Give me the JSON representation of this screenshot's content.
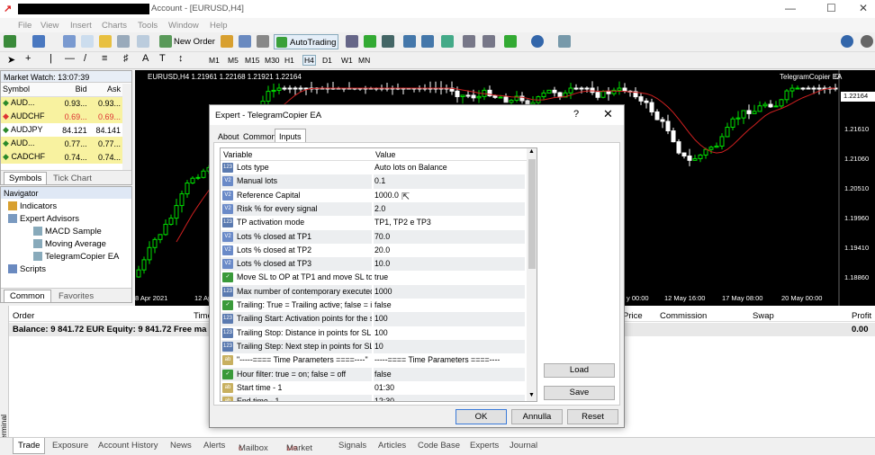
{
  "window": {
    "title": "Account - [EURUSD,H4]"
  },
  "menu": [
    "File",
    "View",
    "Insert",
    "Charts",
    "Tools",
    "Window",
    "Help"
  ],
  "toolbar": {
    "new_order": "New Order",
    "autotrading": "AutoTrading"
  },
  "timeframes": [
    "M1",
    "M5",
    "M15",
    "M30",
    "H1",
    "H4",
    "D1",
    "W1",
    "MN"
  ],
  "market_watch": {
    "title": "Market Watch: 13:07:39",
    "columns": [
      "Symbol",
      "Bid",
      "Ask"
    ],
    "rows": [
      [
        "AUD...",
        "0.93...",
        "0.93..."
      ],
      [
        "AUDCHF",
        "0.69...",
        "0.69..."
      ],
      [
        "AUDJPY",
        "84.121",
        "84.141"
      ],
      [
        "AUD...",
        "0.77...",
        "0.77..."
      ],
      [
        "CADCHF",
        "0.74...",
        "0.74..."
      ]
    ],
    "tabs": [
      "Symbols",
      "Tick Chart"
    ]
  },
  "navigator": {
    "title": "Navigator",
    "items": [
      "Indicators",
      "Expert Advisors",
      "MACD Sample",
      "Moving Average",
      "TelegramCopier EA",
      "Scripts"
    ],
    "tabs": [
      "Common",
      "Favorites"
    ]
  },
  "chart": {
    "symbol_info": "EURUSD,H4 1.21961 1.22168 1.21921 1.22164",
    "ea_label": "TelegramCopier EA",
    "price_labels": [
      "1.22164",
      "1.21610",
      "1.21060",
      "1.20510",
      "1.19960",
      "1.19410",
      "1.18860"
    ],
    "time_labels": [
      "8 Apr 2021",
      "12 Ap",
      "y 00:00",
      "12 May 16:00",
      "17 May 08:00",
      "20 May 00:00"
    ]
  },
  "terminal": {
    "columns": [
      "Order",
      "Time",
      "Price",
      "Commission",
      "Swap",
      "Profit"
    ],
    "balance": "Balance: 9 841.72 EUR  Equity: 9 841.72  Free ma",
    "profit": "0.00"
  },
  "bottom_tabs": [
    {
      "label": "Trade"
    },
    {
      "label": "Exposure"
    },
    {
      "label": "Account History"
    },
    {
      "label": "News"
    },
    {
      "label": "Alerts"
    },
    {
      "label": "Mailbox",
      "badge": "6"
    },
    {
      "label": "Market",
      "badge": "140"
    },
    {
      "label": "Signals"
    },
    {
      "label": "Articles"
    },
    {
      "label": "Code Base"
    },
    {
      "label": "Experts"
    },
    {
      "label": "Journal"
    }
  ],
  "terminal_side_label": "Terminal",
  "dialog": {
    "title": "Expert - TelegramCopier EA",
    "help": "?",
    "tabs": [
      "About",
      "Common",
      "Inputs"
    ],
    "active_tab": "Inputs",
    "columns": [
      "Variable",
      "Value"
    ],
    "rows": [
      {
        "icon": "123",
        "var": "Lots type",
        "val": "Auto lots on Balance"
      },
      {
        "icon": "V2",
        "var": "Manual lots",
        "val": "0.1"
      },
      {
        "icon": "V2",
        "var": "Reference Capital",
        "val": "1000.0"
      },
      {
        "icon": "V2",
        "var": "Risk % for every signal",
        "val": "2.0"
      },
      {
        "icon": "123",
        "var": "TP activation mode",
        "val": "TP1, TP2 e TP3"
      },
      {
        "icon": "V2",
        "var": "Lots % closed at TP1",
        "val": "70.0"
      },
      {
        "icon": "V2",
        "var": "Lots % closed at TP2",
        "val": "20.0"
      },
      {
        "icon": "V2",
        "var": "Lots % closed at TP3",
        "val": "10.0"
      },
      {
        "icon": "chk",
        "var": "Move SL to OP at TP1 and move SL to ...",
        "val": "true"
      },
      {
        "icon": "123",
        "var": "Max number of contemporary executed ...",
        "val": "1000"
      },
      {
        "icon": "chk",
        "var": "Trailing: True = Trailing active; false = in...",
        "val": "false"
      },
      {
        "icon": "123",
        "var": "Trailing Start: Activation points for the st...",
        "val": "100"
      },
      {
        "icon": "123",
        "var": "Trailing Stop: Distance in points for SL ...",
        "val": "100"
      },
      {
        "icon": "123",
        "var": "Trailing Step: Next step in points for SL ...",
        "val": "10"
      },
      {
        "icon": "ab",
        "var": "\"-----==== Time Parameters ====----\"",
        "val": "-----==== Time Parameters ====----"
      },
      {
        "icon": "chk",
        "var": "Hour filter: true = on; false = off",
        "val": "false"
      },
      {
        "icon": "ab",
        "var": "Start time - 1",
        "val": "01:30"
      },
      {
        "icon": "ab",
        "var": "End time - 1",
        "val": "12:30"
      }
    ],
    "buttons": {
      "load": "Load",
      "save": "Save",
      "ok": "OK",
      "cancel": "Annulla",
      "reset": "Reset"
    }
  },
  "colors": {
    "chart_bg": "#000000",
    "bull": "#00e000",
    "bear": "#ffffff",
    "ma": "#d02020",
    "yellow_row": "#f8f2a0"
  }
}
